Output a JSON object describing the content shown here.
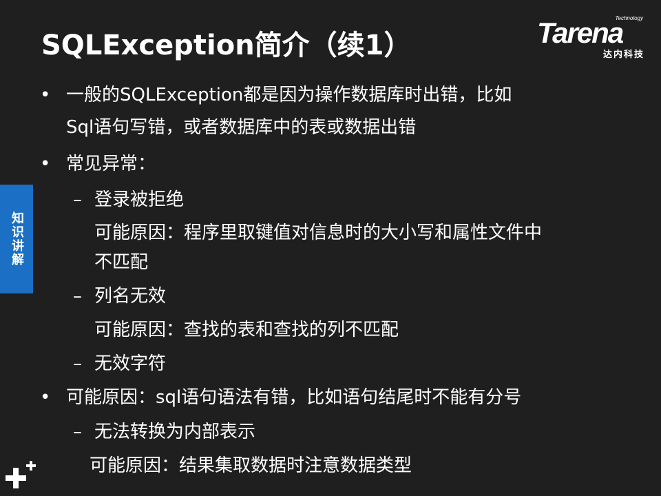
{
  "slide": {
    "title": "SQLException简介（续1）",
    "logo": {
      "tagline": "Technology",
      "brand": "Tarena",
      "subtitle": "达内科技"
    },
    "side_tab": "知识讲解",
    "bullets": [
      {
        "line1": "一般的SQLException都是因为操作数据库时出错，比如",
        "line2": "Sql语句写错，或者数据库中的表或数据出错"
      },
      {
        "line1": "常见异常："
      },
      {
        "sub": "登录被拒绝"
      },
      {
        "detail1": "可能原因：程序里取键值对信息时的大小写和属性文件中",
        "detail2": "不匹配"
      },
      {
        "sub": "列名无效"
      },
      {
        "detail1": "可能原因：查找的表和查找的列不匹配"
      },
      {
        "sub": "无效字符"
      },
      {
        "line1": "可能原因：sql语句语法有错，比如语句结尾时不能有分号"
      },
      {
        "sub": "无法转换为内部表示"
      },
      {
        "detail1": "可能原因：结果集取数据时注意数据类型"
      }
    ]
  }
}
